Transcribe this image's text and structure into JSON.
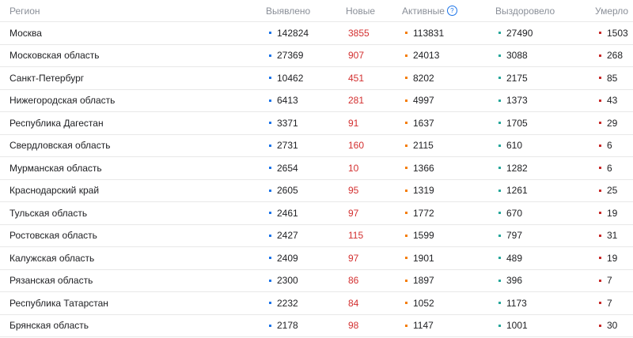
{
  "header": {
    "region": "Регион",
    "found": "Выявлено",
    "new": "Новые",
    "active": "Активные",
    "recovered": "Выздоровело",
    "deaths": "Умерло",
    "help_icon": "?"
  },
  "colors": {
    "found": "#1a73e8",
    "new": "#d32f2f",
    "active": "#f57c00",
    "recovered": "#26a69a",
    "deaths": "#c62828"
  },
  "rows": [
    {
      "region": "Москва",
      "found": "142824",
      "new": "3855",
      "active": "113831",
      "recovered": "27490",
      "deaths": "1503"
    },
    {
      "region": "Московская область",
      "found": "27369",
      "new": "907",
      "active": "24013",
      "recovered": "3088",
      "deaths": "268"
    },
    {
      "region": "Санкт-Петербург",
      "found": "10462",
      "new": "451",
      "active": "8202",
      "recovered": "2175",
      "deaths": "85"
    },
    {
      "region": "Нижегородская область",
      "found": "6413",
      "new": "281",
      "active": "4997",
      "recovered": "1373",
      "deaths": "43"
    },
    {
      "region": "Республика Дагестан",
      "found": "3371",
      "new": "91",
      "active": "1637",
      "recovered": "1705",
      "deaths": "29"
    },
    {
      "region": "Свердловская область",
      "found": "2731",
      "new": "160",
      "active": "2115",
      "recovered": "610",
      "deaths": "6"
    },
    {
      "region": "Мурманская область",
      "found": "2654",
      "new": "10",
      "active": "1366",
      "recovered": "1282",
      "deaths": "6"
    },
    {
      "region": "Краснодарский край",
      "found": "2605",
      "new": "95",
      "active": "1319",
      "recovered": "1261",
      "deaths": "25"
    },
    {
      "region": "Тульская область",
      "found": "2461",
      "new": "97",
      "active": "1772",
      "recovered": "670",
      "deaths": "19"
    },
    {
      "region": "Ростовская область",
      "found": "2427",
      "new": "115",
      "active": "1599",
      "recovered": "797",
      "deaths": "31"
    },
    {
      "region": "Калужская область",
      "found": "2409",
      "new": "97",
      "active": "1901",
      "recovered": "489",
      "deaths": "19"
    },
    {
      "region": "Рязанская область",
      "found": "2300",
      "new": "86",
      "active": "1897",
      "recovered": "396",
      "deaths": "7"
    },
    {
      "region": "Республика Татарстан",
      "found": "2232",
      "new": "84",
      "active": "1052",
      "recovered": "1173",
      "deaths": "7"
    },
    {
      "region": "Брянская область",
      "found": "2178",
      "new": "98",
      "active": "1147",
      "recovered": "1001",
      "deaths": "30"
    }
  ]
}
